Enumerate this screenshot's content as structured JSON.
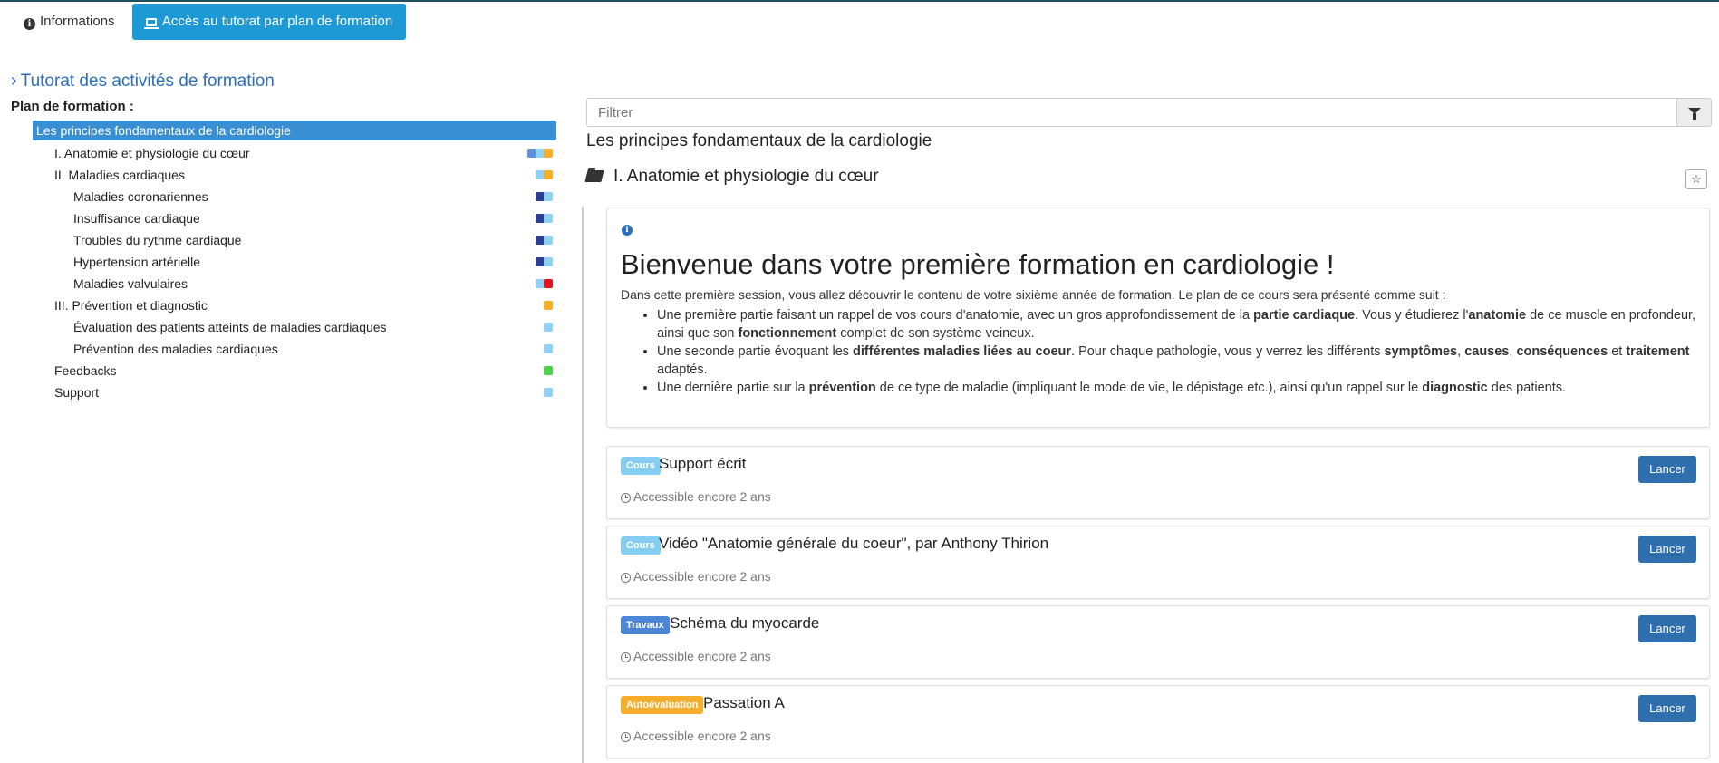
{
  "tabs": {
    "info_label": "Informations",
    "active_label": "Accès au tutorat par plan de formation"
  },
  "sidebar": {
    "section_title": "Tutorat des activités de formation",
    "plan_label": "Plan de formation :",
    "items": [
      {
        "label": "Les principes fondamentaux de la cardiologie",
        "level": 0,
        "indicators": []
      },
      {
        "label": "I. Anatomie et physiologie du cœur",
        "level": 1,
        "indicators": [
          "blue",
          "light",
          "orange"
        ]
      },
      {
        "label": "II. Maladies cardiaques",
        "level": 1,
        "indicators": [
          "light",
          "orange"
        ]
      },
      {
        "label": "Maladies coronariennes",
        "level": 2,
        "indicators": [
          "dark",
          "light"
        ]
      },
      {
        "label": "Insuffisance cardiaque",
        "level": 2,
        "indicators": [
          "dark",
          "light"
        ]
      },
      {
        "label": "Troubles du rythme cardiaque",
        "level": 2,
        "indicators": [
          "dark",
          "light"
        ]
      },
      {
        "label": "Hypertension artérielle",
        "level": 2,
        "indicators": [
          "dark",
          "light"
        ]
      },
      {
        "label": "Maladies valvulaires",
        "level": 2,
        "indicators": [
          "light",
          "red"
        ]
      },
      {
        "label": "III. Prévention et diagnostic",
        "level": 1,
        "indicators": [
          "orange"
        ]
      },
      {
        "label": "Évaluation des patients atteints de maladies cardiaques",
        "level": 2,
        "indicators": [
          "light"
        ]
      },
      {
        "label": "Prévention des maladies cardiaques",
        "level": 2,
        "indicators": [
          "light"
        ]
      },
      {
        "label": "Feedbacks",
        "level": 1,
        "indicators": [
          "green"
        ]
      },
      {
        "label": "Support",
        "level": 1,
        "indicators": [
          "light"
        ]
      }
    ]
  },
  "filter": {
    "placeholder": "Filtrer"
  },
  "main": {
    "course_title": "Les principes fondamentaux de la cardiologie",
    "folder_title": "I. Anatomie et physiologie du cœur",
    "welcome": {
      "heading": "Bienvenue dans votre première formation en cardiologie !",
      "intro": "Dans cette première session, vous allez découvrir le contenu de votre sixième année de formation. Le plan de ce cours sera présenté comme suit :",
      "bullets": [
        [
          {
            "t": "Une première partie faisant un rappel de vos cours d'anatomie, avec un gros approfondissement de la "
          },
          {
            "t": "partie cardiaque",
            "b": true
          },
          {
            "t": ". Vous y étudierez l'"
          },
          {
            "t": "anatomie",
            "b": true
          },
          {
            "t": " de ce muscle en profondeur, ainsi que son "
          },
          {
            "t": "fonctionnement",
            "b": true
          },
          {
            "t": " complet de son système veineux."
          }
        ],
        [
          {
            "t": "Une seconde partie évoquant les "
          },
          {
            "t": "différentes maladies liées au coeur",
            "b": true
          },
          {
            "t": ". Pour chaque pathologie, vous y verrez les différents "
          },
          {
            "t": "symptômes",
            "b": true
          },
          {
            "t": ", "
          },
          {
            "t": "causes",
            "b": true
          },
          {
            "t": ", "
          },
          {
            "t": "conséquences",
            "b": true
          },
          {
            "t": " et "
          },
          {
            "t": "traitement",
            "b": true
          },
          {
            "t": " adaptés."
          }
        ],
        [
          {
            "t": "Une dernière partie sur la "
          },
          {
            "t": "prévention",
            "b": true
          },
          {
            "t": " de ce type de maladie (impliquant le mode de vie, le dépistage etc.), ainsi qu'un rappel sur le "
          },
          {
            "t": "diagnostic",
            "b": true
          },
          {
            "t": " des patients."
          }
        ]
      ]
    },
    "activities": [
      {
        "badge": "Cours",
        "badge_kind": "cours",
        "title": "Support écrit",
        "access": "Accessible encore 2 ans",
        "button": "Lancer"
      },
      {
        "badge": "Cours",
        "badge_kind": "cours",
        "title": "Vidéo \"Anatomie générale du coeur\", par Anthony Thirion",
        "access": "Accessible encore 2 ans",
        "button": "Lancer"
      },
      {
        "badge": "Travaux",
        "badge_kind": "travaux",
        "title": "Schéma du myocarde",
        "access": "Accessible encore 2 ans",
        "button": "Lancer"
      },
      {
        "badge": "Autoévaluation",
        "badge_kind": "auto",
        "title": "Passation A",
        "access": "Accessible encore 2 ans",
        "button": "Lancer"
      }
    ]
  },
  "colors": {
    "accent": "#1d9ad6",
    "link": "#2a6ebb",
    "selected": "#3a8ed2",
    "button": "#2f6fad",
    "badge_cours": "#86cdf2",
    "badge_travaux": "#4d86d6",
    "badge_auto": "#f6ad2a"
  },
  "icons": {
    "info_tab": "info-circle-icon",
    "active_tab": "laptop-icon",
    "section": "chevron-right-icon",
    "filter": "funnel-icon",
    "folder": "folder-open-icon",
    "star": "star-icon",
    "clock": "clock-icon"
  }
}
